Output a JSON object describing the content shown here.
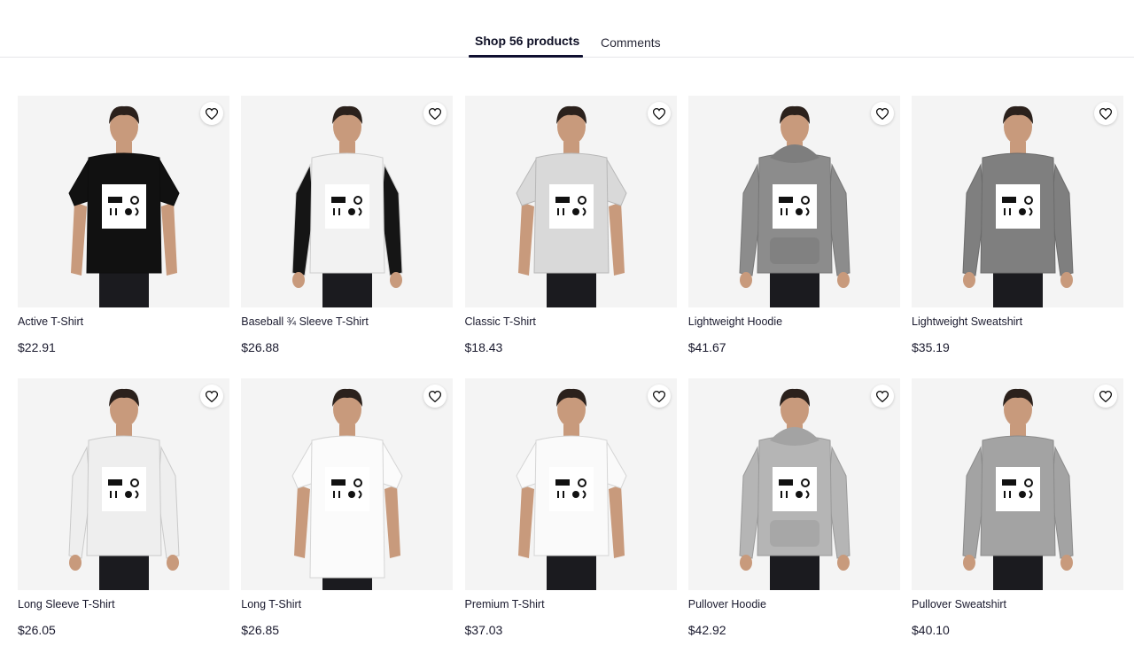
{
  "tabs": {
    "shop_label": "Shop 56 products",
    "comments_label": "Comments"
  },
  "colors": {
    "accent": "#0f1030",
    "image_background": "#f4f4f4",
    "skin": "#c89a7c",
    "hair": "#2b211c"
  },
  "products": [
    {
      "title": "Active T-Shirt",
      "price": "$22.91",
      "garment": "tshirt",
      "color": "#111111",
      "icon": "heart-icon"
    },
    {
      "title": "Baseball ¾ Sleeve T-Shirt",
      "price": "$26.88",
      "garment": "raglan",
      "color": "#f2f2f2",
      "icon": "heart-icon"
    },
    {
      "title": "Classic T-Shirt",
      "price": "$18.43",
      "garment": "tshirt",
      "color": "#d9d9d9",
      "icon": "heart-icon"
    },
    {
      "title": "Lightweight Hoodie",
      "price": "$41.67",
      "garment": "hoodie",
      "color": "#8c8c8c",
      "icon": "heart-icon"
    },
    {
      "title": "Lightweight Sweatshirt",
      "price": "$35.19",
      "garment": "sweatshirt",
      "color": "#7f7f7f",
      "icon": "heart-icon"
    },
    {
      "title": "Long Sleeve T-Shirt",
      "price": "$26.05",
      "garment": "longsleeve",
      "color": "#eeeeee",
      "icon": "heart-icon"
    },
    {
      "title": "Long T-Shirt",
      "price": "$26.85",
      "garment": "longtee",
      "color": "#fbfbfb",
      "icon": "heart-icon"
    },
    {
      "title": "Premium T-Shirt",
      "price": "$37.03",
      "garment": "tshirt",
      "color": "#fafafa",
      "icon": "heart-icon"
    },
    {
      "title": "Pullover Hoodie",
      "price": "$42.92",
      "garment": "hoodie",
      "color": "#b5b5b5",
      "icon": "heart-icon"
    },
    {
      "title": "Pullover Sweatshirt",
      "price": "$40.10",
      "garment": "sweatshirt",
      "color": "#a3a3a3",
      "icon": "heart-icon"
    }
  ]
}
